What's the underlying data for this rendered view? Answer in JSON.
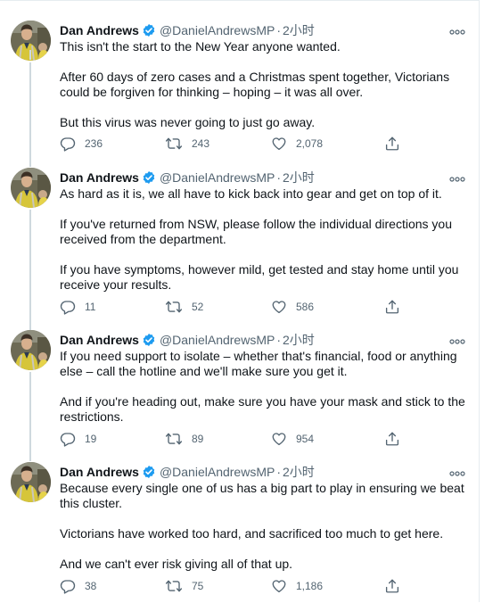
{
  "author": {
    "name": "Dan Andrews",
    "handle": "@DanielAndrewsMP",
    "verified": true,
    "separator": "·"
  },
  "colors": {
    "verified_blue": "#1d9bf0",
    "muted": "#536471",
    "text": "#0f1419",
    "border": "#e6ecf0",
    "thread_line": "#cfd9de"
  },
  "icons": {
    "reply": "reply-icon",
    "retweet": "retweet-icon",
    "like": "heart-icon",
    "share": "share-icon",
    "more": "more-icon",
    "verified": "verified-badge-icon"
  },
  "tweets": [
    {
      "time": "2小时",
      "paragraphs": [
        "This isn't the start to the New Year anyone wanted.",
        "After 60 days of zero cases and a Christmas spent together, Victorians could be forgiven for thinking – hoping – it was all over.",
        "But this virus was never going to just go away."
      ],
      "replies": "236",
      "retweets": "243",
      "likes": "2,078"
    },
    {
      "time": "2小时",
      "paragraphs": [
        "As hard as it is, we all have to kick back into gear and get on top of it.",
        "If you've returned from NSW, please follow the individual directions you received from the department.",
        "If you have symptoms, however mild, get tested and stay home until you receive your results."
      ],
      "replies": "11",
      "retweets": "52",
      "likes": "586"
    },
    {
      "time": "2小时",
      "paragraphs": [
        "If you need support to isolate – whether that's financial, food or anything else – call the hotline and we'll make sure you get it.",
        "And if you're heading out, make sure you have your mask and stick to the restrictions."
      ],
      "replies": "19",
      "retweets": "89",
      "likes": "954"
    },
    {
      "time": "2小时",
      "paragraphs": [
        "Because every single one of us has a big part to play in ensuring we beat this cluster.",
        "Victorians have worked too hard, and sacrificed too much to get here.",
        "And we can't ever risk giving all of that up."
      ],
      "replies": "38",
      "retweets": "75",
      "likes": "1,186"
    }
  ]
}
